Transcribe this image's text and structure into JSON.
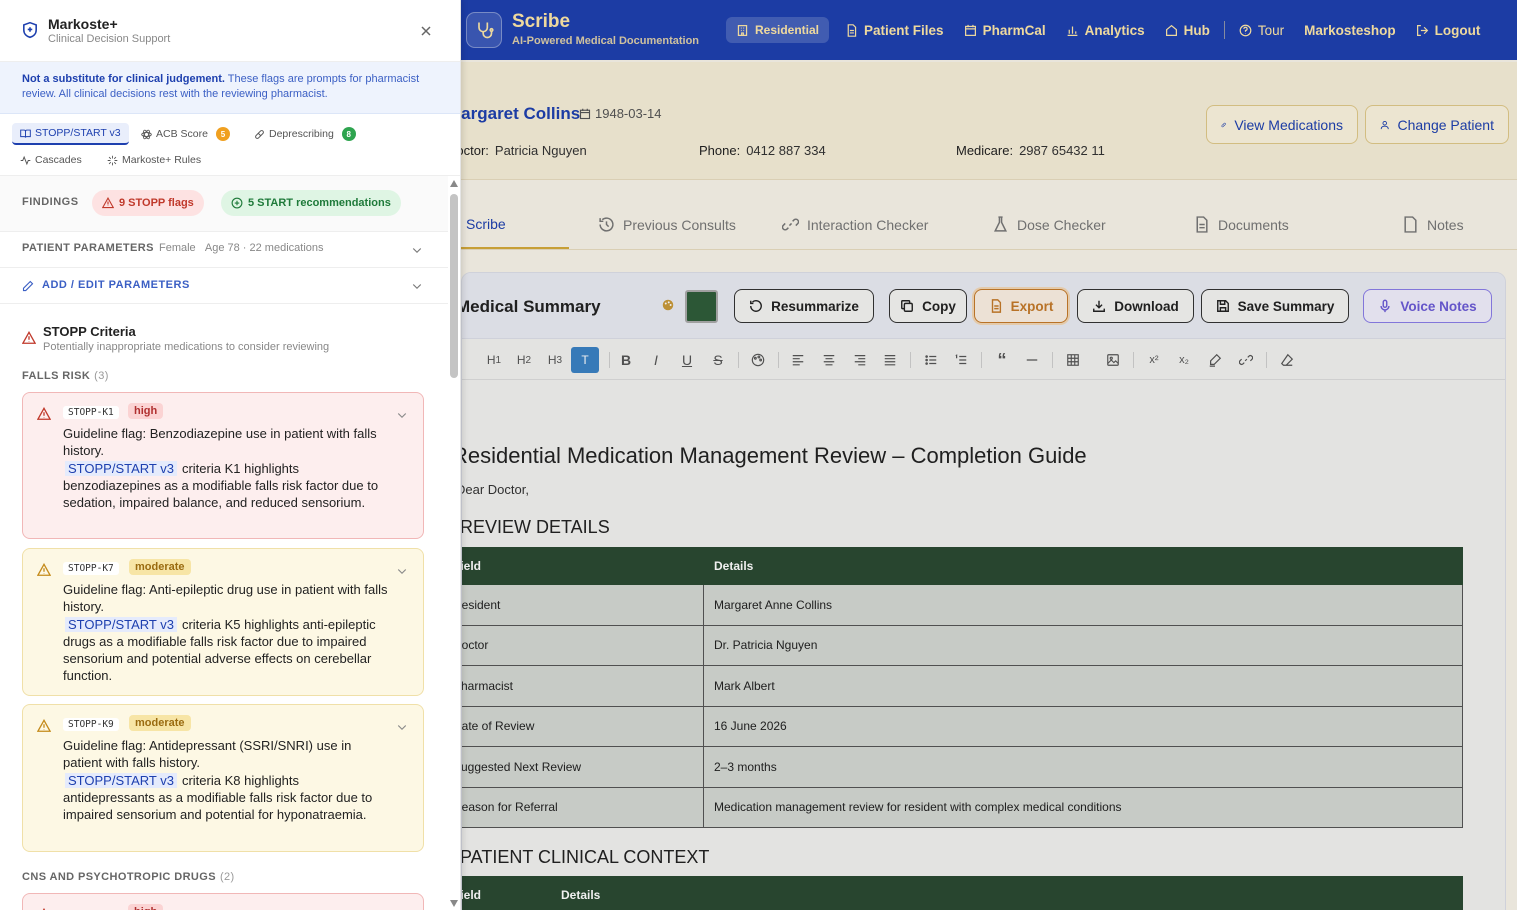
{
  "app": {
    "title": "Scribe",
    "subtitle": "AI-Powered Medical Documentation",
    "nav": [
      {
        "label": "Residential",
        "icon": "building-icon"
      },
      {
        "label": "Patient Files",
        "icon": "file-icon"
      },
      {
        "label": "PharmCal",
        "icon": "calendar-icon"
      },
      {
        "label": "Analytics",
        "icon": "bar-chart-icon"
      },
      {
        "label": "Hub",
        "icon": "home-icon"
      },
      {
        "label": "Tour",
        "icon": "help-icon"
      },
      {
        "label": "Markosteshop",
        "icon": ""
      },
      {
        "label": "Logout",
        "icon": "logout-icon"
      }
    ]
  },
  "patient": {
    "name": "Margaret Collins",
    "dob": "1948-03-14",
    "doctor_label": "Doctor:",
    "doctor": "Patricia Nguyen",
    "phone_label": "Phone:",
    "phone": "0412 887 334",
    "medicare_label": "Medicare:",
    "medicare": "2987 65432 11",
    "view_meds": "View Medications",
    "change_patient": "Change Patient"
  },
  "main_tabs": [
    "Scribe",
    "Previous Consults",
    "Interaction Checker",
    "Dose Checker",
    "Documents",
    "Notes"
  ],
  "editor": {
    "title": "Medical Summary",
    "buttons": {
      "resummarize": "Resummarize",
      "copy": "Copy",
      "export": "Export",
      "download": "Download",
      "save": "Save Summary",
      "voice": "Voice Notes"
    },
    "swatch_color": "#2f5d3a"
  },
  "document": {
    "heading": "Residential Medication Management Review – Completion Guide",
    "salutation": "Dear Doctor,",
    "section1": "REVIEW DETAILS",
    "table1_head": [
      "Field",
      "Details"
    ],
    "table1_rows": [
      [
        "Resident",
        "Margaret Anne Collins"
      ],
      [
        "Doctor",
        "Dr. Patricia Nguyen"
      ],
      [
        "Pharmacist",
        "Mark Albert"
      ],
      [
        "Date of Review",
        "16 June 2026"
      ],
      [
        "Suggested Next Review",
        "2–3 months"
      ],
      [
        "Reason for Referral",
        "Medication management review for resident with complex medical conditions"
      ]
    ],
    "section2": "PATIENT CLINICAL CONTEXT",
    "table2_head": [
      "Field",
      "Details"
    ]
  },
  "panel": {
    "title": "Markoste+",
    "subtitle": "Clinical Decision Support",
    "disclaimer_bold": "Not a substitute for clinical judgement.",
    "disclaimer_rest": " These flags are prompts for pharmacist review. All clinical decisions rest with the reviewing pharmacist.",
    "tabs": [
      {
        "label": "STOPP/START v3"
      },
      {
        "label": "ACB Score",
        "badge": "5",
        "badge_color": "#f0a020"
      },
      {
        "label": "Deprescribing",
        "badge": "8",
        "badge_color": "#2ea44f"
      },
      {
        "label": "Cascades"
      },
      {
        "label": "Markoste+ Rules"
      }
    ],
    "findings_label": "FINDINGS",
    "stopp_flags": "9 STOPP flags",
    "start_recs": "5 START recommendations",
    "params_label": "PATIENT PARAMETERS",
    "params_sex": "Female",
    "params_age": "Age 78",
    "params_meds": "· 22 medications",
    "add_edit": "ADD / EDIT PARAMETERS",
    "criteria_title": "STOPP Criteria",
    "criteria_sub": "Potentially inappropriate medications to consider reviewing",
    "groups": [
      {
        "name": "FALLS RISK",
        "count": "(3)"
      },
      {
        "name": "CNS AND PSYCHOTROPIC DRUGS",
        "count": "(2)"
      }
    ],
    "cards": [
      {
        "code": "STOPP-K1",
        "severity": "high",
        "flag": "Guideline flag: Benzodiazepine use in patient with falls history.",
        "source": "STOPP/START v3",
        "detail": "criteria K1 highlights benzodiazepines as a modifiable falls risk factor due to sedation, impaired balance, and reduced sensorium."
      },
      {
        "code": "STOPP-K7",
        "severity": "moderate",
        "flag": "Guideline flag: Anti-epileptic drug use in patient with falls history.",
        "source": "STOPP/START v3",
        "detail": "criteria K5 highlights anti-epileptic drugs as a modifiable falls risk factor due to impaired sensorium and potential adverse effects on cerebellar function."
      },
      {
        "code": "STOPP-K9",
        "severity": "moderate",
        "flag": "Guideline flag: Antidepressant (SSRI/SNRI) use in patient with falls history.",
        "source": "STOPP/START v3",
        "detail": "criteria K8 highlights antidepressants as a modifiable falls risk factor due to impaired sensorium and potential for hyponatraemia."
      }
    ],
    "next_card_severity": "high"
  }
}
